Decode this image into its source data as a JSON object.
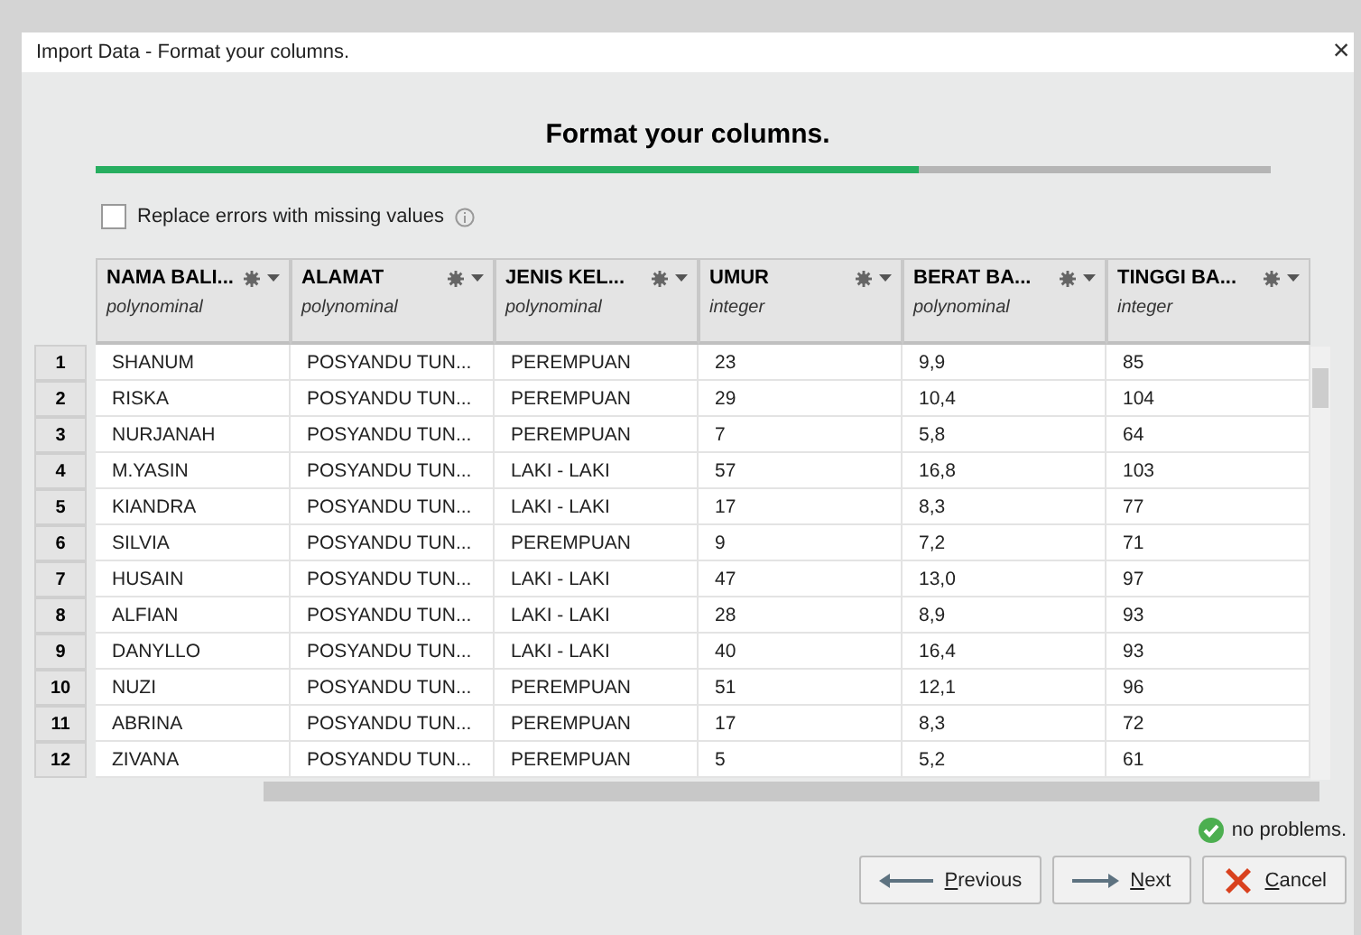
{
  "window": {
    "title": "Import Data - Format your columns.",
    "close": "×"
  },
  "heading": "Format your columns.",
  "progress": {
    "level": 0.7
  },
  "replace_errors": {
    "label": "Replace errors with missing values",
    "checked": false
  },
  "table": {
    "columns": [
      {
        "name": "NAMA BALI...",
        "type": "polynominal"
      },
      {
        "name": "ALAMAT",
        "type": "polynominal"
      },
      {
        "name": "JENIS KEL...",
        "type": "polynominal"
      },
      {
        "name": "UMUR",
        "type": "integer"
      },
      {
        "name": "BERAT BA...",
        "type": "polynominal"
      },
      {
        "name": "TINGGI BA...",
        "type": "integer"
      }
    ],
    "rows": [
      {
        "index": "1",
        "cells": [
          "SHANUM",
          "POSYANDU TUN...",
          "PEREMPUAN",
          "23",
          "9,9",
          "85"
        ]
      },
      {
        "index": "2",
        "cells": [
          "RISKA",
          "POSYANDU TUN...",
          "PEREMPUAN",
          "29",
          "10,4",
          "104"
        ]
      },
      {
        "index": "3",
        "cells": [
          "NURJANAH",
          "POSYANDU TUN...",
          "PEREMPUAN",
          "7",
          "5,8",
          "64"
        ]
      },
      {
        "index": "4",
        "cells": [
          "M.YASIN",
          "POSYANDU TUN...",
          "LAKI - LAKI",
          "57",
          "16,8",
          "103"
        ]
      },
      {
        "index": "5",
        "cells": [
          "KIANDRA",
          "POSYANDU TUN...",
          "LAKI - LAKI",
          "17",
          "8,3",
          "77"
        ]
      },
      {
        "index": "6",
        "cells": [
          "SILVIA",
          "POSYANDU TUN...",
          "PEREMPUAN",
          "9",
          "7,2",
          "71"
        ]
      },
      {
        "index": "7",
        "cells": [
          "HUSAIN",
          "POSYANDU TUN...",
          "LAKI - LAKI",
          "47",
          "13,0",
          "97"
        ]
      },
      {
        "index": "8",
        "cells": [
          "ALFIAN",
          "POSYANDU TUN...",
          "LAKI - LAKI",
          "28",
          "8,9",
          "93"
        ]
      },
      {
        "index": "9",
        "cells": [
          "DANYLLO",
          "POSYANDU TUN...",
          "LAKI - LAKI",
          "40",
          "16,4",
          "93"
        ]
      },
      {
        "index": "10",
        "cells": [
          "NUZI",
          "POSYANDU TUN...",
          "PEREMPUAN",
          "51",
          "12,1",
          "96"
        ]
      },
      {
        "index": "11",
        "cells": [
          "ABRINA",
          "POSYANDU TUN...",
          "PEREMPUAN",
          "17",
          "8,3",
          "72"
        ]
      },
      {
        "index": "12",
        "cells": [
          "ZIVANA",
          "POSYANDU TUN...",
          "PEREMPUAN",
          "5",
          "5,2",
          "61"
        ]
      }
    ]
  },
  "status": "no problems.",
  "buttons": [
    {
      "label": "Previous",
      "kind": "previous"
    },
    {
      "label": "Next",
      "kind": "next"
    },
    {
      "label": "Cancel",
      "kind": "cancel"
    }
  ]
}
